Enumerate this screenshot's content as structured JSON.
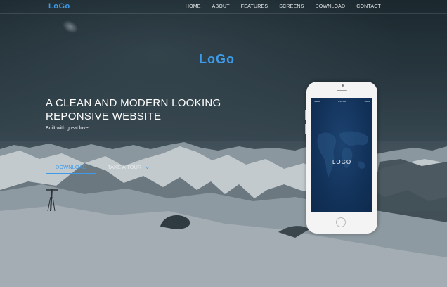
{
  "nav": {
    "logo": "LoGo",
    "items": [
      "HOME",
      "ABOUT",
      "FEATURES",
      "SCREENS",
      "DOWNLOAD",
      "CONTACT"
    ]
  },
  "hero": {
    "logo": "LoGo",
    "headline_line1": "A CLEAN AND MODERN LOOKING",
    "headline_line2": "REPONSIVE WEBSITE",
    "tagline": "Built with great love!",
    "download_label": "DOWNLOAD",
    "tour_label": "TAKE A TOUR",
    "tour_icon": "chevron-down-icon"
  },
  "phone": {
    "carrier": "Sketch",
    "time": "9:41 PM",
    "battery": "100%",
    "screen_logo": "LOGO"
  },
  "colors": {
    "accent": "#3d9be9",
    "screen": "#12325a"
  }
}
